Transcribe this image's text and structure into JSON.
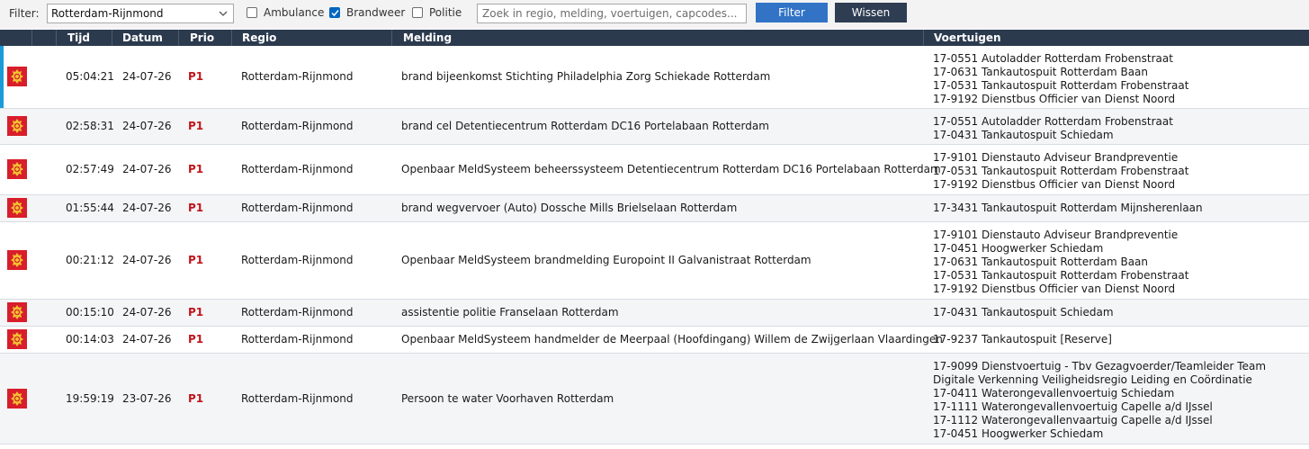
{
  "filter": {
    "label": "Filter:",
    "region_selected": "Rotterdam-Rijnmond",
    "checkboxes": [
      {
        "label": "Ambulance",
        "checked": false
      },
      {
        "label": "Brandweer",
        "checked": true
      },
      {
        "label": "Politie",
        "checked": false
      }
    ],
    "search_placeholder": "Zoek in regio, melding, voertuigen, capcodes...",
    "filter_button": "Filter",
    "clear_button": "Wissen"
  },
  "colors": {
    "header_bg": "#2c3a4e",
    "filter_button": "#3273c6",
    "clear_button": "#2e3d52",
    "prio_red": "#c0161b",
    "selected_accent": "#1a9bd7",
    "brandweer_red": "#d81e2a"
  },
  "table": {
    "columns": [
      "Tijd",
      "Datum",
      "Prio",
      "Regio",
      "Melding",
      "Voertuigen"
    ],
    "rows": [
      {
        "service_icon": "brandweer-logo-icon",
        "time": "05:04:21",
        "date": "24-07-26",
        "prio": "P1",
        "region": "Rotterdam-Rijnmond",
        "message": "brand bijeenkomst Stichting Philadelphia Zorg Schiekade Rotterdam",
        "vehicles": [
          "17-0551 Autoladder Rotterdam Frobenstraat",
          "17-0631 Tankautospuit Rotterdam Baan",
          "17-0531 Tankautospuit Rotterdam Frobenstraat",
          "17-9192 Dienstbus Officier van Dienst Noord"
        ]
      },
      {
        "service_icon": "brandweer-logo-icon",
        "time": "02:58:31",
        "date": "24-07-26",
        "prio": "P1",
        "region": "Rotterdam-Rijnmond",
        "message": "brand cel Detentiecentrum Rotterdam DC16 Portelabaan Rotterdam",
        "vehicles": [
          "17-0551 Autoladder Rotterdam Frobenstraat",
          "17-0431 Tankautospuit Schiedam"
        ]
      },
      {
        "service_icon": "brandweer-logo-icon",
        "time": "02:57:49",
        "date": "24-07-26",
        "prio": "P1",
        "region": "Rotterdam-Rijnmond",
        "message": "Openbaar MeldSysteem beheerssysteem Detentiecentrum Rotterdam DC16 Portelabaan Rotterdam",
        "vehicles": [
          "17-9101 Dienstauto Adviseur Brandpreventie",
          "17-0531 Tankautospuit Rotterdam Frobenstraat",
          "17-9192 Dienstbus Officier van Dienst Noord"
        ]
      },
      {
        "service_icon": "brandweer-logo-icon",
        "time": "01:55:44",
        "date": "24-07-26",
        "prio": "P1",
        "region": "Rotterdam-Rijnmond",
        "message": "brand wegvervoer (Auto) Dossche Mills Brielselaan Rotterdam",
        "vehicles": [
          "17-3431 Tankautospuit Rotterdam Mijnsherenlaan"
        ]
      },
      {
        "service_icon": "brandweer-logo-icon",
        "time": "00:21:12",
        "date": "24-07-26",
        "prio": "P1",
        "region": "Rotterdam-Rijnmond",
        "message": "Openbaar MeldSysteem brandmelding Europoint II Galvanistraat Rotterdam",
        "vehicles": [
          "17-9101 Dienstauto Adviseur Brandpreventie",
          "17-0451 Hoogwerker Schiedam",
          "17-0631 Tankautospuit Rotterdam Baan",
          "17-0531 Tankautospuit Rotterdam Frobenstraat",
          "17-9192 Dienstbus Officier van Dienst Noord"
        ]
      },
      {
        "service_icon": "brandweer-logo-icon",
        "time": "00:15:10",
        "date": "24-07-26",
        "prio": "P1",
        "region": "Rotterdam-Rijnmond",
        "message": "assistentie politie Franselaan Rotterdam",
        "vehicles": [
          "17-0431 Tankautospuit Schiedam"
        ]
      },
      {
        "service_icon": "brandweer-logo-icon",
        "time": "00:14:03",
        "date": "24-07-26",
        "prio": "P1",
        "region": "Rotterdam-Rijnmond",
        "message": "Openbaar MeldSysteem handmelder de Meerpaal (Hoofdingang) Willem de Zwijgerlaan Vlaardingen",
        "vehicles": [
          "17-9237 Tankautospuit [Reserve]"
        ]
      },
      {
        "service_icon": "brandweer-logo-icon",
        "time": "19:59:19",
        "date": "23-07-26",
        "prio": "P1",
        "region": "Rotterdam-Rijnmond",
        "message": "Persoon te water Voorhaven Rotterdam",
        "vehicles": [
          "17-9099 Dienstvoertuig - Tbv Gezagvoerder/Teamleider Team Digitale Verkenning Veiligheidsregio Leiding en Coördinatie",
          "17-0411 Waterongevallenvoertuig Schiedam",
          "17-1111 Waterongevallenvoertuig Capelle a/d IJssel",
          "17-1112 Waterongevallenvaartuig Capelle a/d IJssel",
          "17-0451 Hoogwerker Schiedam"
        ]
      }
    ]
  }
}
